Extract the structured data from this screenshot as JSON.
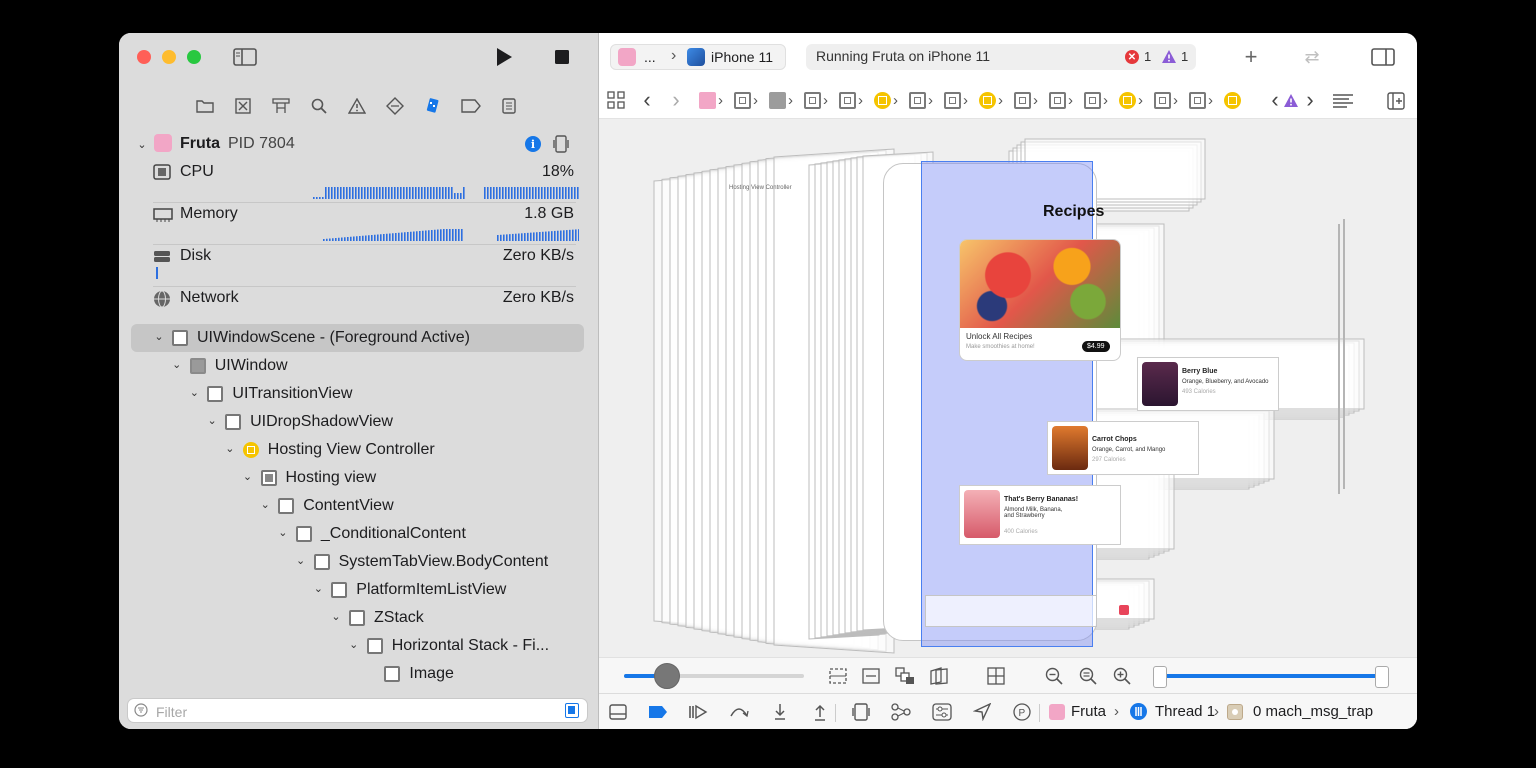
{
  "process": {
    "name": "Fruta",
    "pid_label": "PID 7804"
  },
  "gauges": [
    {
      "label": "CPU",
      "value": "18%"
    },
    {
      "label": "Memory",
      "value": "1.8 GB"
    },
    {
      "label": "Disk",
      "value": "Zero KB/s"
    },
    {
      "label": "Network",
      "value": "Zero KB/s"
    }
  ],
  "tree": [
    {
      "label": "UIWindowScene - (Foreground Active)"
    },
    {
      "label": "UIWindow"
    },
    {
      "label": "UITransitionView"
    },
    {
      "label": "UIDropShadowView"
    },
    {
      "label": "Hosting View Controller"
    },
    {
      "label": "Hosting view"
    },
    {
      "label": "ContentView"
    },
    {
      "label": "_ConditionalContent"
    },
    {
      "label": "SystemTabView.BodyContent"
    },
    {
      "label": "PlatformItemListView"
    },
    {
      "label": "ZStack"
    },
    {
      "label": "Horizontal Stack - Fi..."
    },
    {
      "label": "Image"
    }
  ],
  "filter": {
    "placeholder": "Filter"
  },
  "toolbar": {
    "scheme_app": "...",
    "scheme_device": "iPhone 11",
    "status_text": "Running Fruta on iPhone 11",
    "error_count": "1",
    "warning_count": "1"
  },
  "canvas": {
    "screen_title": "Recipes",
    "hero_title": "Unlock All Recipes",
    "hero_subtitle": "Make smoothies at home!",
    "hero_price": "$4.99",
    "items": [
      {
        "name": "Berry Blue",
        "ingredients": "Orange, Blueberry, and Avocado",
        "calories": "493 Calories"
      },
      {
        "name": "Carrot Chops",
        "ingredients": "Orange, Carrot, and Mango",
        "calories": "297 Calories"
      },
      {
        "name": "That's Berry Bananas!",
        "ingredients": "Almond Milk, Banana, and Strawberry",
        "calories": "400 Calories"
      }
    ],
    "hvc_caption": "Hosting View Controller"
  },
  "debug": {
    "process_crumb": "Fruta",
    "thread_crumb": "Thread 1",
    "frame_crumb": "0 mach_msg_trap"
  },
  "colors": {
    "accent": "#1677e8",
    "error": "#e5383b",
    "warning": "#8b5cd6",
    "selection_overlay": "#7f8ff5"
  }
}
